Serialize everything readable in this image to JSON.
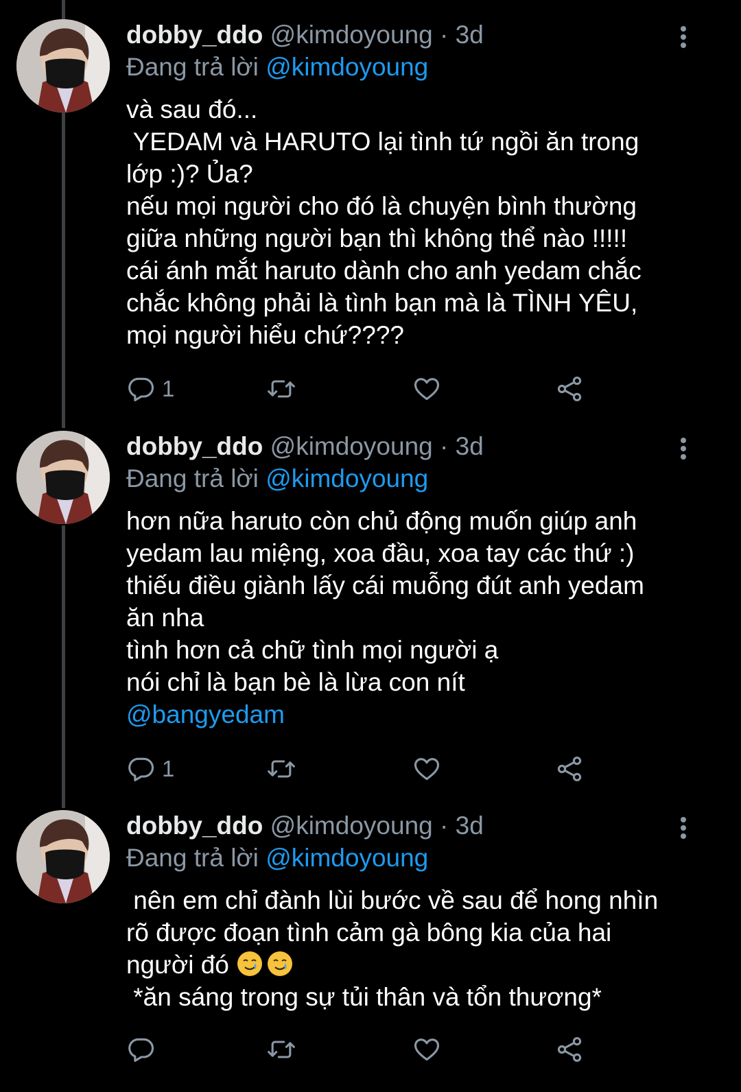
{
  "tweets": [
    {
      "name": "dobby_ddo",
      "handle": "@kimdoyoung",
      "dot": "·",
      "time": "3d",
      "reply_prefix": "Đang trả lời",
      "reply_to": "@kimdoyoung",
      "lines": [
        "và sau đó...",
        " YEDAM và HARUTO lại tình tứ ngồi ăn trong",
        "lớp :)? Ủa?",
        "nếu mọi người cho đó là chuyện bình thường",
        "giữa những người bạn thì không thể nào !!!!!",
        "cái ánh mắt haruto dành cho anh yedam chắc",
        "chắc không phải là tình bạn mà là TÌNH YÊU,",
        "mọi người hiểu chứ????"
      ],
      "reply_count": "1"
    },
    {
      "name": "dobby_ddo",
      "handle": "@kimdoyoung",
      "dot": "·",
      "time": "3d",
      "reply_prefix": "Đang trả lời",
      "reply_to": "@kimdoyoung",
      "lines": [
        "hơn nữa haruto còn chủ động muốn giúp anh",
        "yedam lau miệng, xoa đầu, xoa tay các thứ :)",
        "thiếu điều giành lấy cái muỗng đút anh yedam",
        "ăn nha",
        "tình hơn cả chữ tình mọi người ạ",
        "nói chỉ là bạn bè là lừa con nít"
      ],
      "mention": "@bangyedam",
      "reply_count": "1"
    },
    {
      "name": "dobby_ddo",
      "handle": "@kimdoyoung",
      "dot": "·",
      "time": "3d",
      "reply_prefix": "Đang trả lời",
      "reply_to": "@kimdoyoung",
      "lines": [
        " nên em chỉ đành lùi bước về sau để hong nhìn",
        "rõ được đoạn tình cảm gà bông kia của hai",
        "người đó",
        " *ăn sáng trong sự tủi thân và tổn thương*"
      ],
      "emoji": [
        "smiling-face-with-tear",
        "smiling-face-with-tear"
      ],
      "reply_count": ""
    }
  ],
  "colors": {
    "background": "#000000",
    "text": "#ffffff",
    "secondary": "#8b98a5",
    "link": "#1d9bf0",
    "thread_line": "#3d4145"
  }
}
